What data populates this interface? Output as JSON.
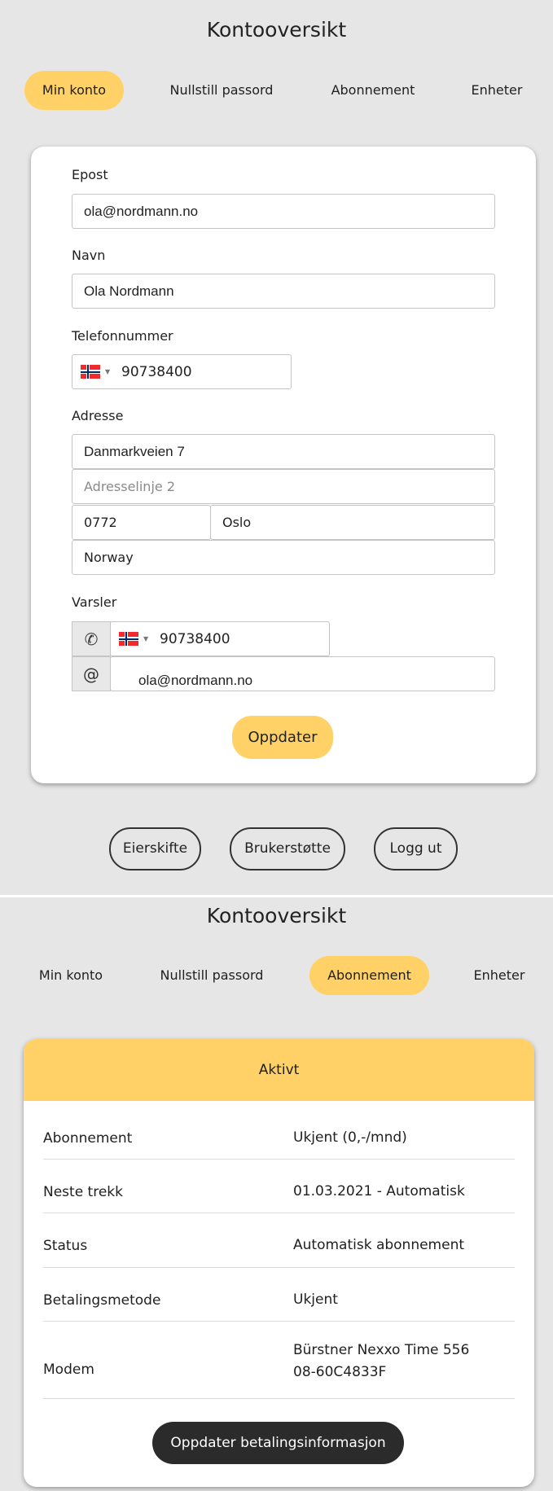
{
  "screen1": {
    "title": "Kontooversikt",
    "tabs": [
      {
        "label": "Min konto",
        "active": true
      },
      {
        "label": "Nullstill passord",
        "active": false
      },
      {
        "label": "Abonnement",
        "active": false
      },
      {
        "label": "Enheter",
        "active": false
      }
    ],
    "form": {
      "email_label": "Epost",
      "email_value": "ola@nordmann.no",
      "name_label": "Navn",
      "name_value": "Ola Nordmann",
      "phone_label": "Telefonnummer",
      "phone_value": "90738400",
      "address_label": "Adresse",
      "address_line1": "Danmarkveien 7",
      "address_line2_placeholder": "Adresselinje 2",
      "postal_code": "0772",
      "city": "Oslo",
      "country": "Norway",
      "notifications_label": "Varsler",
      "notify_phone": "90738400",
      "notify_email": "ola@nordmann.no",
      "update_button": "Oppdater"
    },
    "footer_buttons": {
      "owner_change": "Eierskifte",
      "support": "Brukerstøtte",
      "logout": "Logg ut"
    }
  },
  "screen2": {
    "title": "Kontooversikt",
    "tabs": [
      {
        "label": "Min konto",
        "active": false
      },
      {
        "label": "Nullstill passord",
        "active": false
      },
      {
        "label": "Abonnement",
        "active": true
      },
      {
        "label": "Enheter",
        "active": false
      }
    ],
    "subscription": {
      "header": "Aktivt",
      "rows": [
        {
          "label": "Abonnement",
          "value": "Ukjent (0,-/mnd)"
        },
        {
          "label": "Neste trekk",
          "value": "01.03.2021 - Automatisk"
        },
        {
          "label": "Status",
          "value": "Automatisk abonnement"
        },
        {
          "label": "Betalingsmetode",
          "value": "Ukjent"
        },
        {
          "label": "Modem",
          "value": "Bürstner Nexxo Time 556 08-60C4833F"
        }
      ],
      "update_payment_button": "Oppdater betalingsinformasjon"
    }
  },
  "colors": {
    "accent": "#ffd167",
    "background": "#e6e6e6",
    "dark_button": "#2b2b2b"
  },
  "icons": {
    "flag": "norway-flag-icon",
    "phone": "phone-icon",
    "email": "at-sign-icon"
  }
}
